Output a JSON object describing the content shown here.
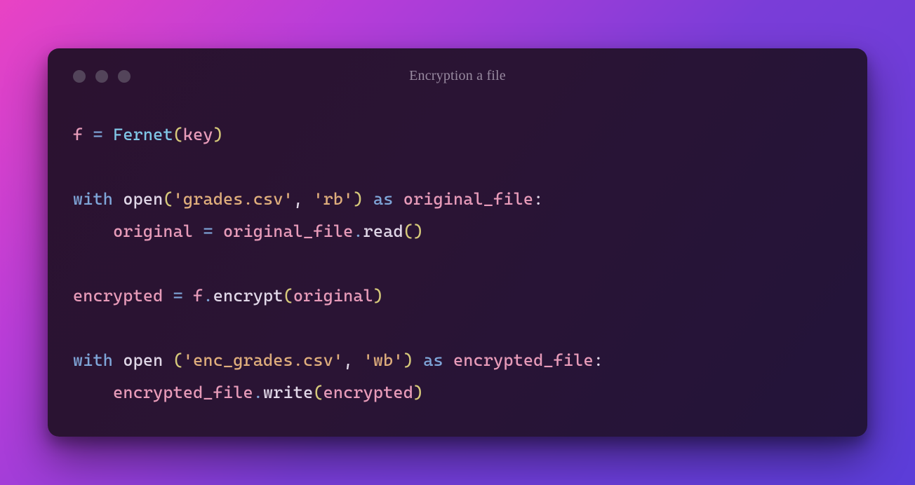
{
  "window": {
    "title": "Encryption a file"
  },
  "code": {
    "l1": {
      "v_f": "f",
      "eq": "=",
      "cls": "Fernet",
      "lp": "(",
      "arg_key": "key",
      "rp": ")"
    },
    "l2": {
      "kw_with": "with",
      "fn_open": "open",
      "lp": "(",
      "s_file": "'grades.csv'",
      "comma": ",",
      "s_mode": "'rb'",
      "rp": ")",
      "kw_as": "as",
      "v_of": "original_file",
      "colon": ":"
    },
    "l3": {
      "indent": "    ",
      "v_orig": "original",
      "eq": "=",
      "v_of": "original_file",
      "dot": ".",
      "fn_read": "read",
      "lp": "(",
      "rp": ")"
    },
    "l4": {
      "v_enc": "encrypted",
      "eq": "=",
      "v_f": "f",
      "dot": ".",
      "fn_encrypt": "encrypt",
      "lp": "(",
      "arg": "original",
      "rp": ")"
    },
    "l5": {
      "kw_with": "with",
      "fn_open": "open ",
      "lp": "(",
      "s_file": "'enc_grades.csv'",
      "comma": ",",
      "s_mode": "'wb'",
      "rp": ")",
      "kw_as": "as",
      "v_ef": "encrypted_file",
      "colon": ":"
    },
    "l6": {
      "indent": "    ",
      "v_ef": "encrypted_file",
      "dot": ".",
      "fn_write": "write",
      "lp": "(",
      "arg": "encrypted",
      "rp": ")"
    }
  }
}
